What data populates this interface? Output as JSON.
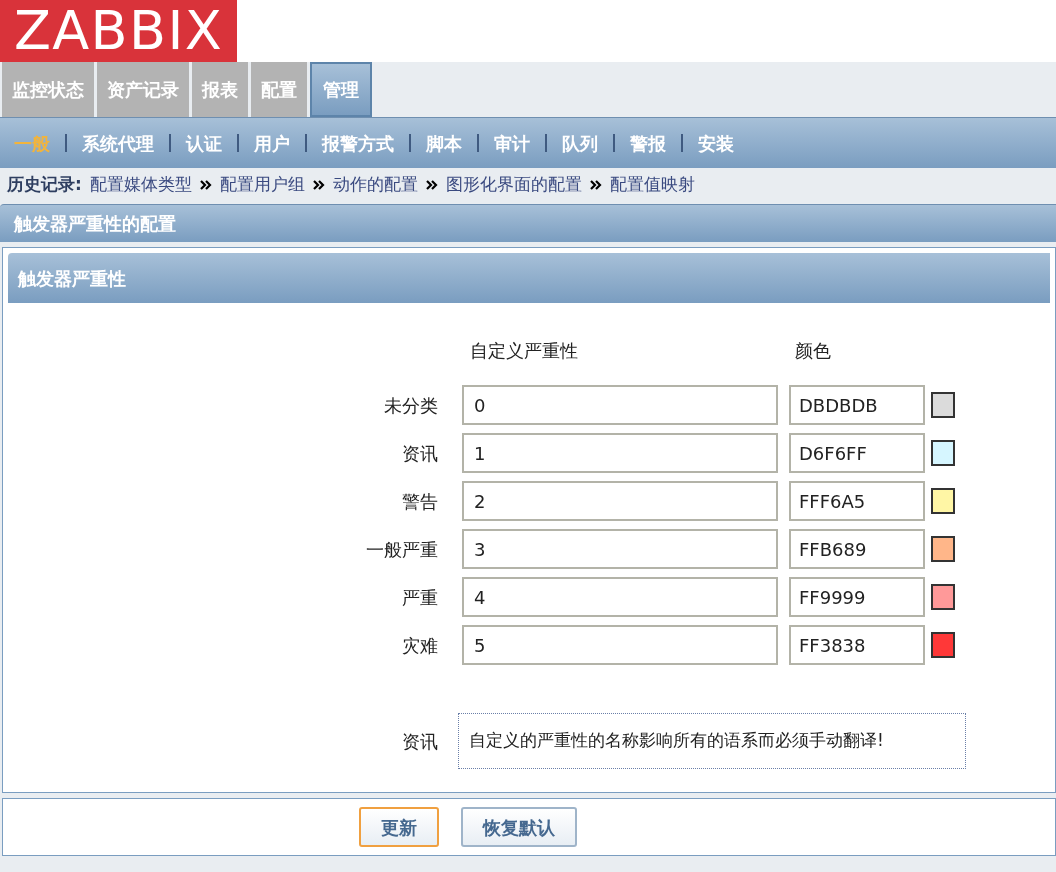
{
  "logo": "ZABBIX",
  "main_tabs": [
    {
      "label": "监控状态",
      "selected": false
    },
    {
      "label": "资产记录",
      "selected": false
    },
    {
      "label": "报表",
      "selected": false
    },
    {
      "label": "配置",
      "selected": false
    },
    {
      "label": "管理",
      "selected": true
    }
  ],
  "sub_tabs": [
    {
      "label": "一般",
      "selected": true
    },
    {
      "label": "系统代理",
      "selected": false
    },
    {
      "label": "认证",
      "selected": false
    },
    {
      "label": "用户",
      "selected": false
    },
    {
      "label": "报警方式",
      "selected": false
    },
    {
      "label": "脚本",
      "selected": false
    },
    {
      "label": "审计",
      "selected": false
    },
    {
      "label": "队列",
      "selected": false
    },
    {
      "label": "警报",
      "selected": false
    },
    {
      "label": "安装",
      "selected": false
    }
  ],
  "history": {
    "label": "历史记录:",
    "items": [
      "配置媒体类型",
      "配置用户组",
      "动作的配置",
      "图形化界面的配置",
      "配置值映射"
    ]
  },
  "page_title": "触发器严重性的配置",
  "section": {
    "title": "触发器严重性",
    "columns": [
      "自定义严重性",
      "颜色"
    ],
    "rows": [
      {
        "name": "未分类",
        "value": "0",
        "color_code": "DBDBDB",
        "color": "#dbdbdb"
      },
      {
        "name": "资讯",
        "value": "1",
        "color_code": "D6F6FF",
        "color": "#d6f6ff"
      },
      {
        "name": "警告",
        "value": "2",
        "color_code": "FFF6A5",
        "color": "#fff6a5"
      },
      {
        "name": "一般严重",
        "value": "3",
        "color_code": "FFB689",
        "color": "#ffb689"
      },
      {
        "name": "严重",
        "value": "4",
        "color_code": "FF9999",
        "color": "#ff9999"
      },
      {
        "name": "灾难",
        "value": "5",
        "color_code": "FF3838",
        "color": "#ff3838"
      }
    ],
    "info": {
      "label": "资讯",
      "text": "自定义的严重性的名称影响所有的语系而必须手动翻译!"
    }
  },
  "buttons": [
    {
      "label": "更新",
      "kind": "primary"
    },
    {
      "label": "恢复默认",
      "kind": "secondary"
    }
  ]
}
